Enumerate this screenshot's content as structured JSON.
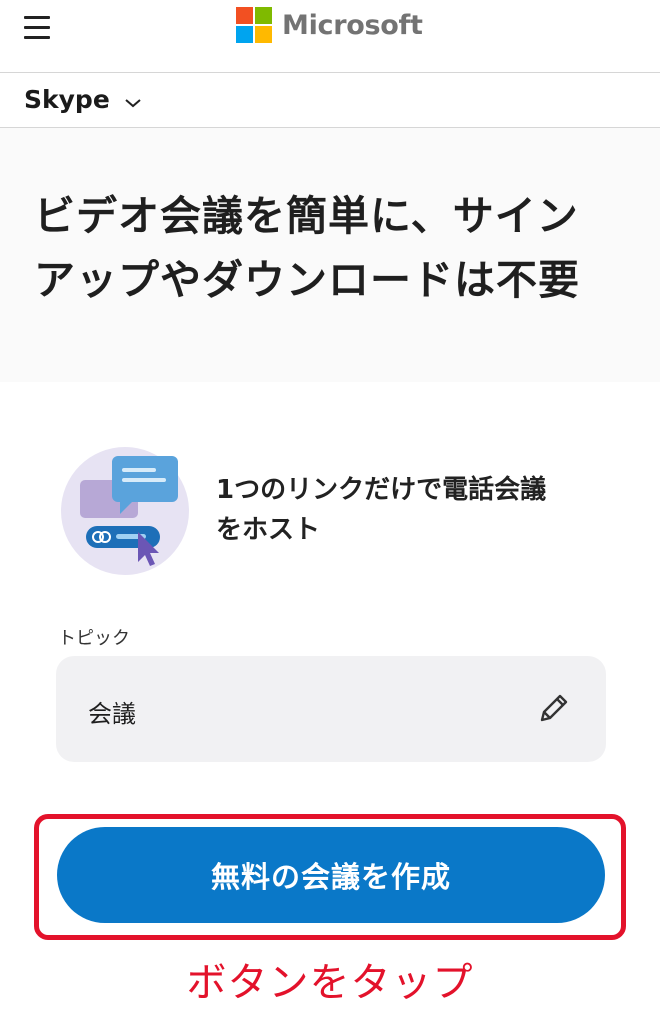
{
  "header": {
    "brand": "Microsoft",
    "logo_colors": [
      "#f25022",
      "#7fba00",
      "#00a4ef",
      "#ffb900"
    ]
  },
  "subnav": {
    "product": "Skype"
  },
  "hero": {
    "title_line1": "ビデオ会議を簡単に、サイン",
    "title_line2": "アップやダウンロードは不要"
  },
  "feature": {
    "text_line1": "1つのリンクだけで電話会議",
    "text_line2": "をホスト"
  },
  "topic": {
    "label": "トピック",
    "value": "会議"
  },
  "cta": {
    "label": "無料の会議を作成",
    "color": "#0a78c8"
  },
  "annotation": {
    "text": "ボタンをタップ",
    "color": "#e3122b"
  }
}
